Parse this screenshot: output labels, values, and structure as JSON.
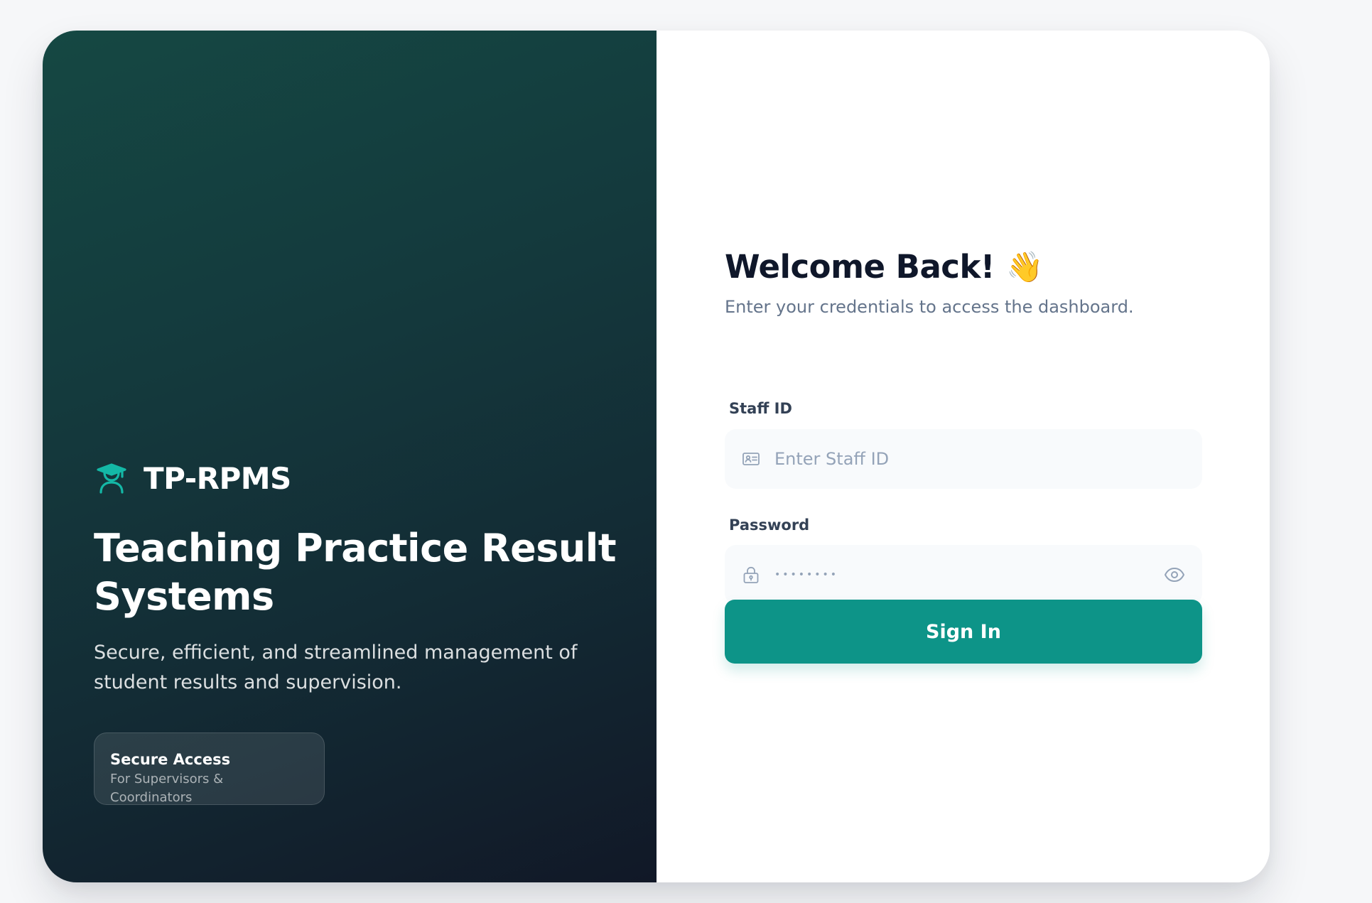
{
  "brand": {
    "name": "TP-RPMS",
    "icon": "graduation-cap-icon",
    "accent_color": "#14b8a6"
  },
  "hero": {
    "headline": "Teaching Practice Result Systems",
    "tagline": "Secure, efficient, and streamlined management of student results and supervision.",
    "badge": {
      "title": "Secure Access",
      "subtitle": "For Supervisors & Coordinators"
    }
  },
  "login": {
    "title": "Welcome Back!",
    "title_emoji": "👋",
    "subtitle": "Enter your credentials to access the dashboard.",
    "staff_id": {
      "label": "Staff ID",
      "placeholder": "Enter Staff ID",
      "value": "",
      "icon": "id-card-icon"
    },
    "password": {
      "label": "Password",
      "value": "••••••••",
      "icon": "lock-icon",
      "toggle_icon": "eye-icon"
    },
    "submit_label": "Sign In",
    "button_color": "#0d9488"
  }
}
